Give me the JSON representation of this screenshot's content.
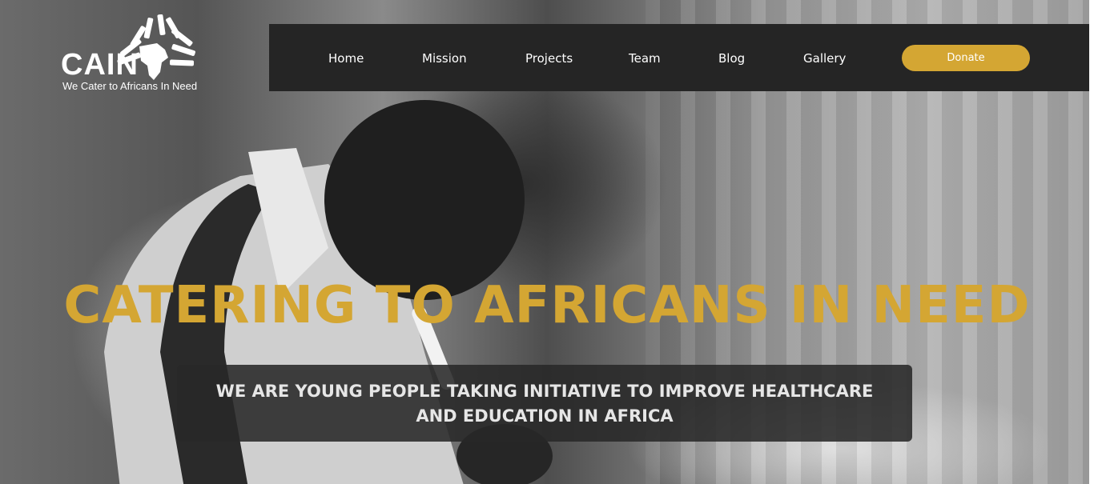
{
  "logo": {
    "name": "CAIN",
    "tagline": "We Cater to Africans In Need"
  },
  "nav": {
    "items": [
      {
        "label": "Home"
      },
      {
        "label": "Mission"
      },
      {
        "label": "Projects"
      },
      {
        "label": "Team"
      },
      {
        "label": "Blog"
      },
      {
        "label": "Gallery"
      }
    ],
    "donate_label": "Donate"
  },
  "hero": {
    "headline": "CATERING TO AFRICANS IN NEED",
    "subtitle": "WE ARE YOUNG PEOPLE TAKING INITIATIVE TO IMPROVE HEALTHCARE AND EDUCATION IN AFRICA"
  },
  "colors": {
    "accent": "#d4a633",
    "navbar": "#252525",
    "text_light": "#ffffff"
  }
}
